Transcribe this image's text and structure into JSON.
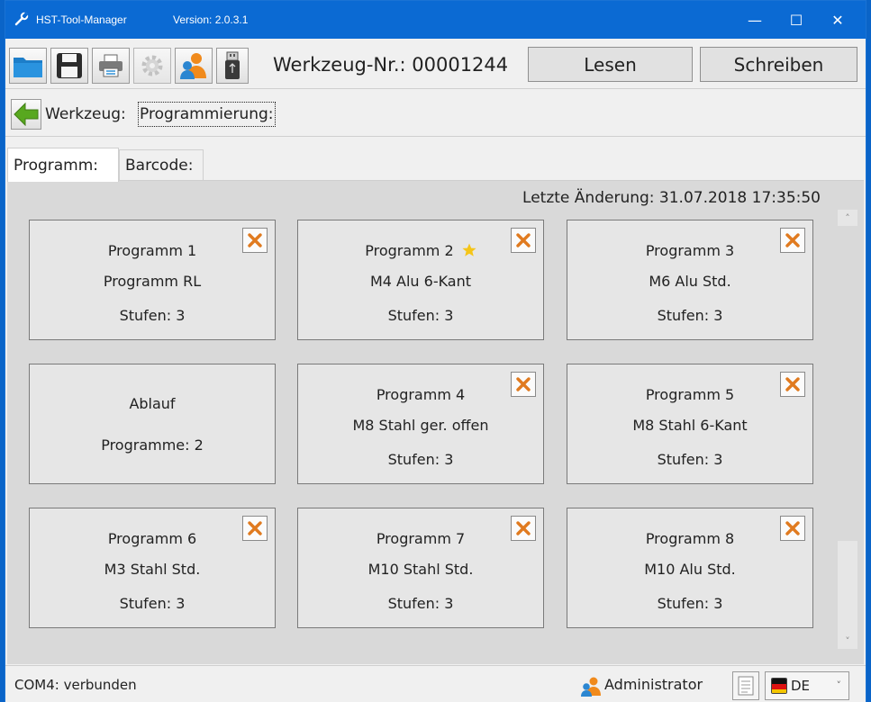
{
  "window": {
    "title": "HST-Tool-Manager",
    "version": "Version: 2.0.3.1",
    "controls": [
      "—",
      "☐",
      "✕"
    ]
  },
  "toolbar": {
    "werkzeug_nr": "Werkzeug-Nr.: 00001244",
    "lesen_label": "Lesen",
    "schreiben_label": "Schreiben",
    "icons": [
      "folder-icon",
      "save-icon",
      "printer-icon",
      "gear-icon",
      "user-icon",
      "usb-drive-icon"
    ]
  },
  "breadcrumb": {
    "part1": "Werkzeug:",
    "part2": "Programmierung:"
  },
  "tabs": [
    {
      "label": "Programm:"
    },
    {
      "label": "Barcode:"
    }
  ],
  "content": {
    "last_change": "Letzte Änderung:  31.07.2018  17:35:50",
    "cards": [
      {
        "l1": "Programm 1",
        "l2": "Programm RL",
        "l3": "Stufen: 3",
        "deletable": true,
        "star": false
      },
      {
        "l1": "Programm 2",
        "l2": "M4 Alu 6-Kant",
        "l3": "Stufen: 3",
        "deletable": true,
        "star": true
      },
      {
        "l1": "Programm 3",
        "l2": "M6 Alu Std.",
        "l3": "Stufen: 3",
        "deletable": true,
        "star": false
      },
      {
        "l1": "Ablauf",
        "l2": "Programme: 2",
        "deletable": false
      },
      {
        "l1": "Programm 4",
        "l2": "M8 Stahl ger. offen",
        "l3": "Stufen: 3",
        "deletable": true,
        "star": false
      },
      {
        "l1": "Programm 5",
        "l2": "M8 Stahl 6-Kant",
        "l3": "Stufen: 3",
        "deletable": true,
        "star": false
      },
      {
        "l1": "Programm 6",
        "l2": "M3 Stahl Std.",
        "l3": "Stufen: 3",
        "deletable": true,
        "star": false
      },
      {
        "l1": "Programm 7",
        "l2": "M10 Stahl Std.",
        "l3": "Stufen: 3",
        "deletable": true,
        "star": false
      },
      {
        "l1": "Programm 8",
        "l2": "M10 Alu Std.",
        "l3": "Stufen: 3",
        "deletable": true,
        "star": false
      }
    ]
  },
  "statusbar": {
    "connection": "COM4: verbunden",
    "user": "Administrator",
    "language": "DE"
  },
  "colors": {
    "titlebar": "#0b6ad3",
    "accent_orange": "#e07a1f",
    "star": "#f5c518"
  }
}
